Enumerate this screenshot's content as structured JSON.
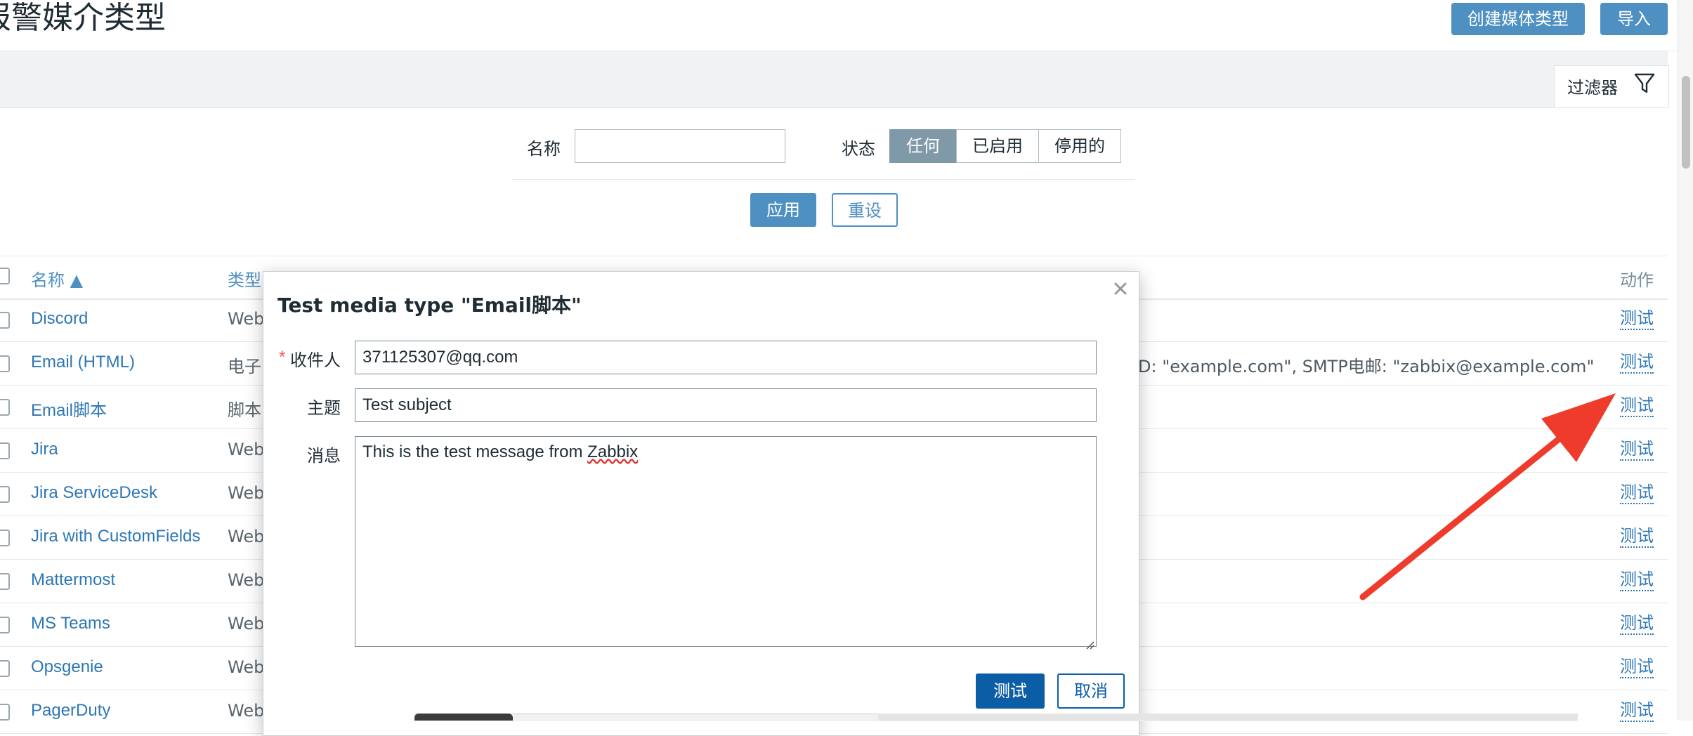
{
  "header": {
    "title": "报警媒介类型",
    "create_button": "创建媒体类型",
    "import_button": "导入"
  },
  "filter": {
    "tab_label": "过滤器",
    "tab_icon": "funnel-icon",
    "name_label": "名称",
    "name_value": "",
    "status_label": "状态",
    "status_options": [
      "任何",
      "已启用",
      "停用的"
    ],
    "status_selected": "任何",
    "apply_button": "应用",
    "reset_button": "重设"
  },
  "table": {
    "columns": {
      "name": "名称 ▲",
      "type": "类型",
      "actions": "动作"
    },
    "rows": [
      {
        "name": "Discord",
        "type": "Web",
        "details": "",
        "action": "测试"
      },
      {
        "name": "Email (HTML)",
        "type": "电子",
        "details": "D: \"example.com\", SMTP电邮: \"zabbix@example.com\"",
        "action": "测试"
      },
      {
        "name": "Email脚本",
        "type": "脚本",
        "details": "",
        "action": "测试"
      },
      {
        "name": "Jira",
        "type": "Web",
        "details": "",
        "action": "测试"
      },
      {
        "name": "Jira ServiceDesk",
        "type": "Web",
        "details": "",
        "action": "测试"
      },
      {
        "name": "Jira with CustomFields",
        "type": "Web",
        "details": "",
        "action": "测试"
      },
      {
        "name": "Mattermost",
        "type": "Web",
        "details": "",
        "action": "测试"
      },
      {
        "name": "MS Teams",
        "type": "Web",
        "details": "",
        "action": "测试"
      },
      {
        "name": "Opsgenie",
        "type": "Web",
        "details": "",
        "action": "测试"
      },
      {
        "name": "PagerDuty",
        "type": "Web",
        "details": "",
        "action": "测试"
      }
    ]
  },
  "modal": {
    "title": "Test media type \"Email脚本\"",
    "required_marker": "*",
    "recipient_label": "收件人",
    "recipient_value": "371125307@qq.com",
    "subject_label": "主题",
    "subject_value": "Test subject",
    "message_label": "消息",
    "message_prefix": "This is the test message from ",
    "message_misspelled": "Zabbix",
    "test_button": "测试",
    "cancel_button": "取消",
    "close_icon": "close-icon"
  },
  "annotation": {
    "arrow_color": "#ee3b2b"
  }
}
